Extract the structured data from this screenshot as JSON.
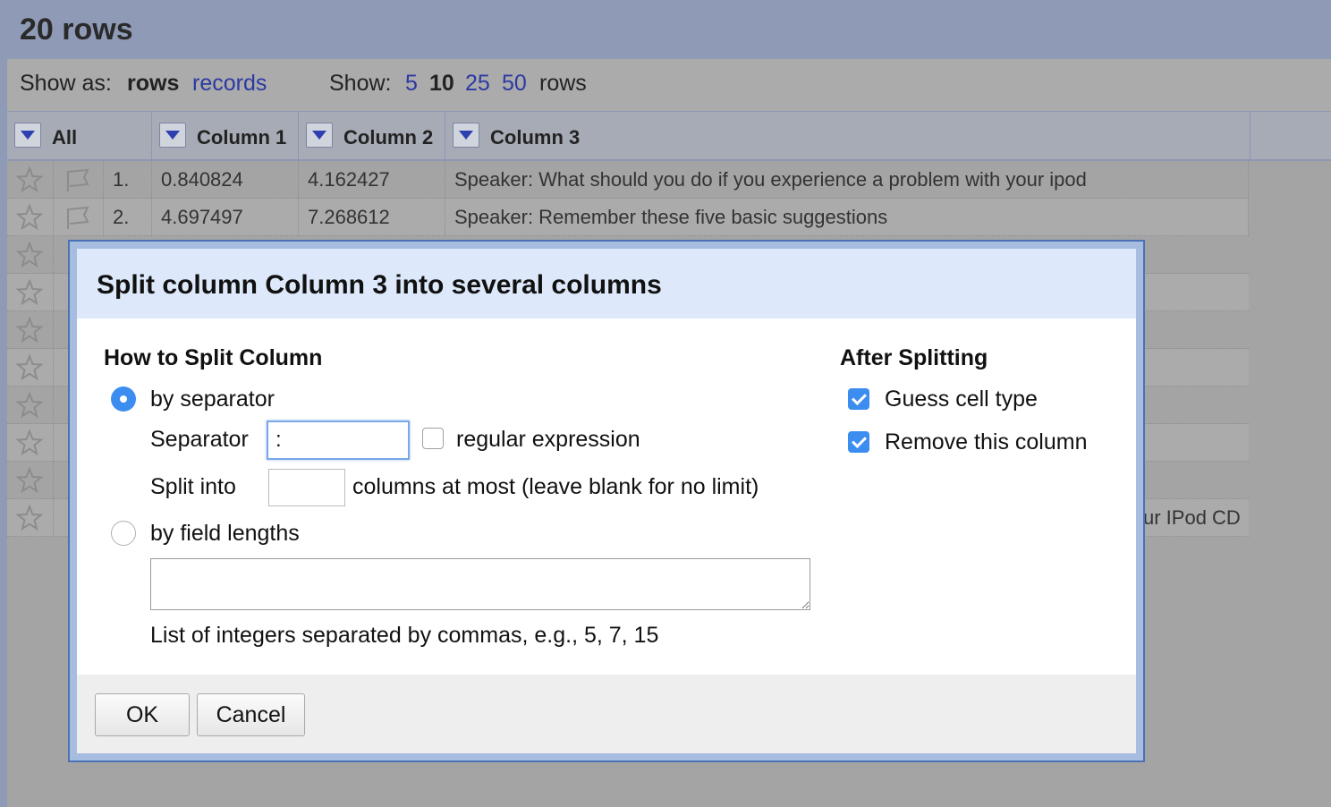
{
  "header": {
    "title": "20 rows"
  },
  "toolbar": {
    "show_as_label": "Show as:",
    "rows_mode": "rows",
    "records_mode": "records",
    "show_label": "Show:",
    "page_sizes": [
      "5",
      "10",
      "25",
      "50"
    ],
    "page_size_selected": "10",
    "rows_suffix": "rows"
  },
  "columns": {
    "all": "All",
    "col1": "Column 1",
    "col2": "Column 2",
    "col3": "Column 3"
  },
  "rows": [
    {
      "num": "1.",
      "c1": "0.840824",
      "c2": "4.162427",
      "c3": "Speaker: What should you do if you experience a problem with your ipod"
    },
    {
      "num": "2.",
      "c1": "4.697497",
      "c2": "7.268612",
      "c3": "Speaker: Remember these five basic suggestions"
    }
  ],
  "partial_cell_text": "ur IPod CD",
  "dialog": {
    "title": "Split column Column 3 into several columns",
    "how_heading": "How to Split Column",
    "by_separator": "by separator",
    "separator_label": "Separator",
    "separator_value": ":",
    "regex_label": "regular expression",
    "split_into_label": "Split into",
    "split_into_value": "",
    "split_into_suffix": "columns at most (leave blank for no limit)",
    "by_field_lengths": "by field lengths",
    "field_lengths_value": "",
    "field_lengths_hint": "List of integers separated by commas, e.g., 5, 7, 15",
    "after_heading": "After Splitting",
    "guess_cell_type": "Guess cell type",
    "remove_column": "Remove this column",
    "ok_label": "OK",
    "cancel_label": "Cancel"
  },
  "state": {
    "method": "by separator",
    "regular_expression": false,
    "guess_cell_type": true,
    "remove_this_column": true
  }
}
